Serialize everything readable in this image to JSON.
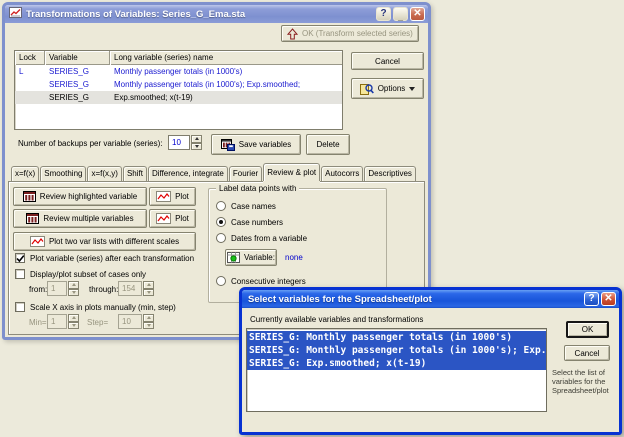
{
  "main_dialog": {
    "title": "Transformations of Variables: Series_G_Ema.sta",
    "window_buttons": {
      "help": "?",
      "minimize": "_",
      "close": "✕"
    },
    "ok_button_label": "OK (Transform selected series)",
    "cancel_label": "Cancel",
    "options_label": "Options",
    "variables_list": {
      "columns": [
        "Lock",
        "Variable",
        "Long variable (series) name"
      ],
      "rows": [
        {
          "lock": "L",
          "variable": "SERIES_G",
          "long_name": "Monthly passenger totals (in 1000's)"
        },
        {
          "lock": "",
          "variable": "SERIES_G",
          "long_name": "Monthly passenger totals (in 1000's); Exp.smoothed;"
        },
        {
          "lock": "",
          "variable": "SERIES_G",
          "long_name": "Exp.smoothed; x(t-19)"
        }
      ]
    },
    "backups_label": "Number of backups per variable (series):",
    "backups_value": "10",
    "save_variables_label": "Save variables",
    "delete_label": "Delete",
    "tabs": [
      "x=f(x)",
      "Smoothing",
      "x=f(x,y)",
      "Shift",
      "Difference, integrate",
      "Fourier",
      "Review & plot",
      "Autocorrs",
      "Descriptives"
    ],
    "active_tab": "Review & plot",
    "review_plot_tab": {
      "review_highlighted_label": "Review highlighted variable",
      "plot_label": "Plot",
      "review_multiple_label": "Review multiple variables",
      "plot2_label": "Plot",
      "plot_two_lists_label": "Plot two var lists with different scales",
      "plot_after_transform_label": "Plot variable (series) after each transformation",
      "subset_label": "Display/plot subset of cases only",
      "from_label": "from:",
      "from_value": "1",
      "through_label": "through:",
      "through_value": "154",
      "scale_x_label": "Scale X axis in plots manually (min, step)",
      "min_label": "Min=",
      "min_value": "1",
      "step_label": "Step=",
      "step_value": "10",
      "label_points_group": {
        "legend": "Label data points with",
        "case_names_label": "Case names",
        "case_numbers_label": "Case numbers",
        "dates_label": "Dates from a variable",
        "variable_button_label": "Variable:",
        "variable_value": "none",
        "consecutive_label": "Consecutive integers"
      }
    }
  },
  "select_dialog": {
    "title": "Select variables for the Spreadsheet/plot",
    "window_buttons": {
      "help": "?",
      "close": "✕"
    },
    "list_caption": "Currently available variables and transformations",
    "items": [
      "SERIES_G: Monthly passenger totals (in 1000's)",
      "SERIES_G: Monthly passenger totals (in 1000's); Exp.",
      "SERIES_G: Exp.smoothed; x(t-19)"
    ],
    "ok_label": "OK",
    "cancel_label": "Cancel",
    "help_text": "Select the list of variables for the Spreadsheet/plot"
  },
  "colors": {
    "desktop": "#eceadb",
    "dialog_face": "#ece9d8",
    "active_title_blue": "#1854da",
    "inactive_title_blue": "#8d9dd8",
    "selection_blue": "#2b55c4",
    "variable_text_blue": "#1a1ad0",
    "link_blue": "#0000cc",
    "plot_line_red": "#e00000"
  }
}
